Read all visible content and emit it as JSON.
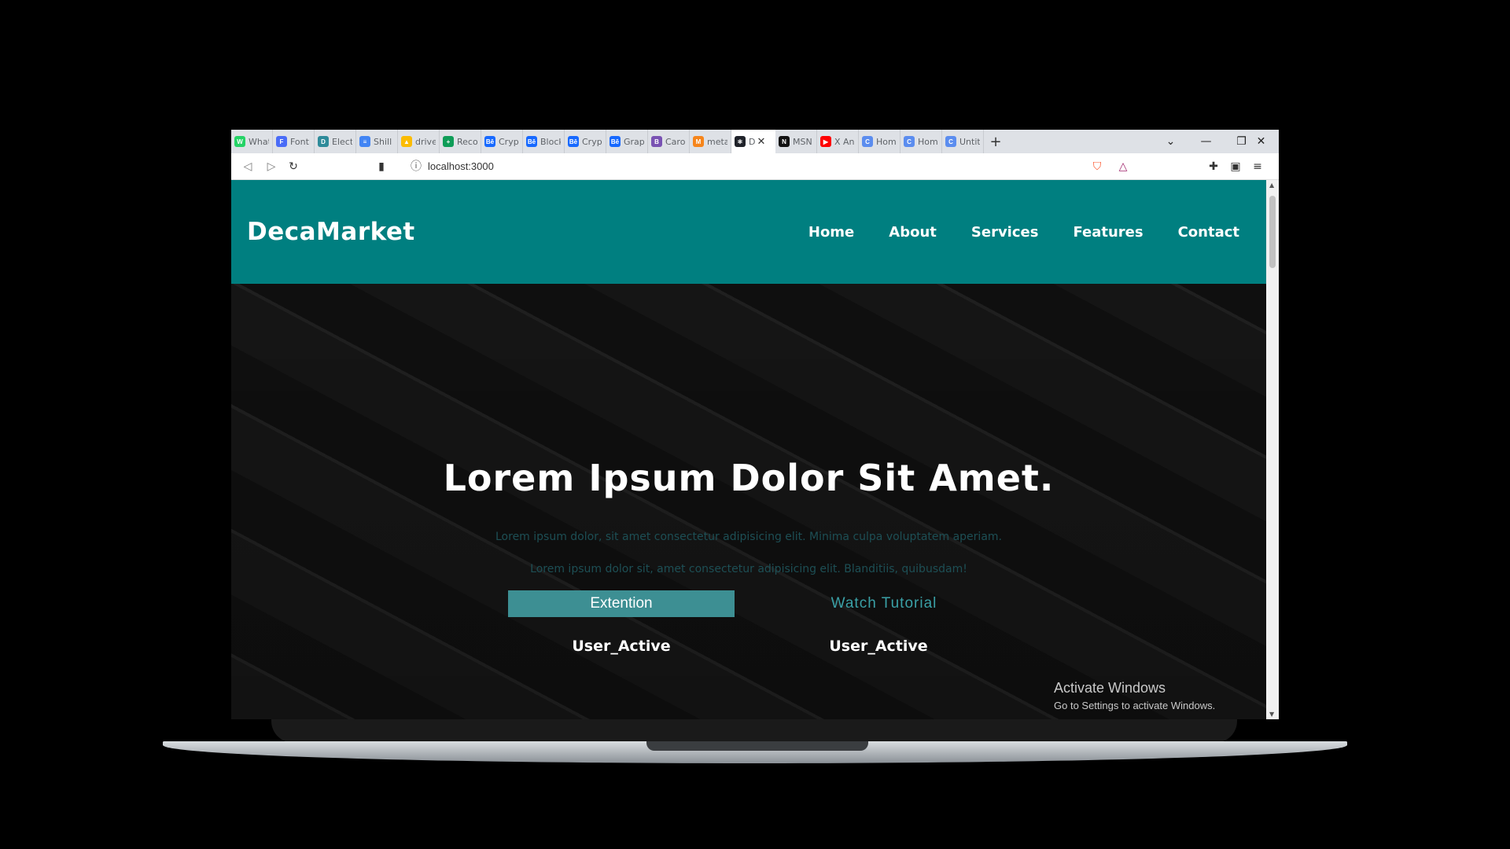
{
  "browser": {
    "tabs": [
      {
        "title": "What",
        "color": "#25d366",
        "glyph": "W"
      },
      {
        "title": "Font",
        "color": "#4a6cf7",
        "glyph": "F"
      },
      {
        "title": "Electr",
        "color": "#2e8b9a",
        "glyph": "D"
      },
      {
        "title": "Shill",
        "color": "#4285f4",
        "glyph": "≡"
      },
      {
        "title": "drive",
        "color": "#fbbc04",
        "glyph": "▲"
      },
      {
        "title": "Reco",
        "color": "#0f9d58",
        "glyph": "+"
      },
      {
        "title": "Crypt",
        "color": "#1769ff",
        "glyph": "Bē"
      },
      {
        "title": "Block",
        "color": "#1769ff",
        "glyph": "Bē"
      },
      {
        "title": "Crypt",
        "color": "#1769ff",
        "glyph": "Bē"
      },
      {
        "title": "Grap",
        "color": "#1769ff",
        "glyph": "Bē"
      },
      {
        "title": "Carou",
        "color": "#7952b3",
        "glyph": "B"
      },
      {
        "title": "meta",
        "color": "#f6851b",
        "glyph": "M"
      },
      {
        "title": "D",
        "color": "#20232a",
        "glyph": "⚛",
        "active": true
      },
      {
        "title": "MSN",
        "color": "#111111",
        "glyph": "N"
      },
      {
        "title": "X An",
        "color": "#ff0000",
        "glyph": "▶"
      },
      {
        "title": "Hom",
        "color": "#5b8def",
        "glyph": "C"
      },
      {
        "title": "Hom",
        "color": "#5b8def",
        "glyph": "C"
      },
      {
        "title": "Untit",
        "color": "#5b8def",
        "glyph": "C"
      }
    ],
    "url": "localhost:3000"
  },
  "site": {
    "brand": "DecaMarket",
    "nav": [
      "Home",
      "About",
      "Services",
      "Features",
      "Contact"
    ],
    "hero_title": "Lorem Ipsum Dolor Sit Amet.",
    "hero_sub1": "Lorem ipsum dolor, sit amet consectetur adipisicing elit. Minima culpa voluptatem aperiam.",
    "hero_sub2": "Lorem ipsum dolor sit, amet consectetur adipisicing elit. Blanditiis, quibusdam!",
    "btn_extension": "Extention",
    "btn_watch": "Watch Tutorial",
    "user_active_1": "User_Active",
    "user_active_2": "User_Active",
    "nav_color": "#007f80"
  },
  "os_watermark": {
    "line1": "Activate Windows",
    "line2": "Go to Settings to activate Windows."
  }
}
